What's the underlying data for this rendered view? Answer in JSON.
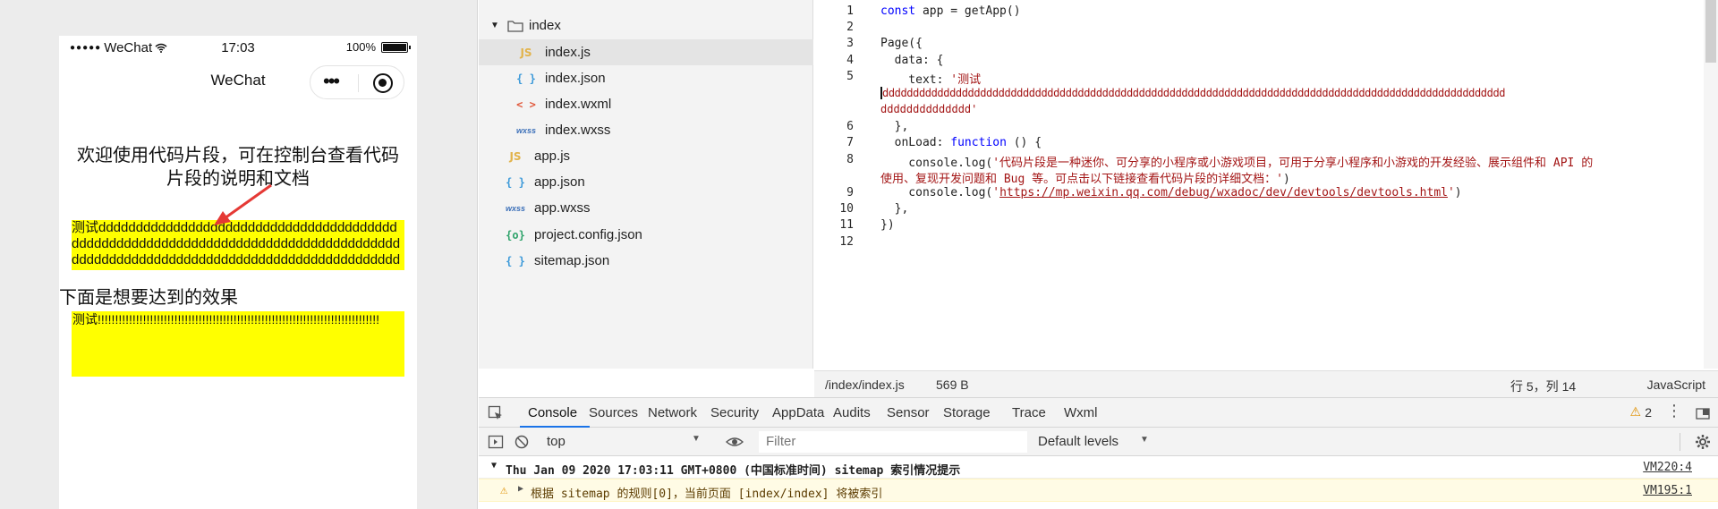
{
  "simulator": {
    "status": {
      "carrier": "WeChat",
      "time": "17:03",
      "battery": "100%"
    },
    "nav_title": "WeChat",
    "intro": "欢迎使用代码片段，可在控制台查看代码片段的说明和文档",
    "text1": "测试dddddddddddddddddddddddddddddddddddddddddddddddddddddddddddddddddddddddddddddddddddddddddddddddddddddddddddddddddddddddddddddddddddddddddddd",
    "below_label": "下面是想要达到的效果",
    "text2": "测试!!!!!!!!!!!!!!!!!!!!!!!!!!!!!!!!!!!!!!!!!!!!!!!!!!!!!!!!!!!!!!!!!!!!!!!!!!!!!!!!!"
  },
  "file_tree": {
    "folder": "index",
    "items": [
      {
        "icon": "JS",
        "kind": "js",
        "label": "index.js",
        "selected": true
      },
      {
        "icon": "{ }",
        "kind": "json",
        "label": "index.json"
      },
      {
        "icon": "< >",
        "kind": "wxml",
        "label": "index.wxml"
      },
      {
        "icon": "wxss",
        "kind": "wxss",
        "label": "index.wxss"
      },
      {
        "icon": "JS",
        "kind": "js",
        "label": "app.js"
      },
      {
        "icon": "{ }",
        "kind": "json",
        "label": "app.json"
      },
      {
        "icon": "wxss",
        "kind": "wxss",
        "label": "app.wxss"
      },
      {
        "icon": "{o}",
        "kind": "cfg",
        "label": "project.config.json"
      },
      {
        "icon": "{ }",
        "kind": "json",
        "label": "sitemap.json"
      }
    ]
  },
  "editor": {
    "line_numbers": [
      "1",
      "2",
      "3",
      "4",
      "5",
      "6",
      "7",
      "8",
      "9",
      "10",
      "11",
      "12"
    ],
    "code": {
      "l1_kw": "const",
      "l1_rest": " app = getApp()",
      "l3": "Page({",
      "l4": "  data: {",
      "l5_key": "    text: ",
      "l5_str": "'测试",
      "l5_wrap1": "dddddddddddddddddddddddddddddddddddddddddddddddddddddddddddddddddddddddddddddddddddddddddddddddddddddd",
      "l5_wrap2": "dddddddddddddd'",
      "l6": "  },",
      "l7_a": "  onLoad: ",
      "l7_kw": "function",
      "l7_b": " () {",
      "l8_a": "    console.log(",
      "l8_str1": "'代码片段是一种迷你、可分享的小程序或小游戏项目，可用于分享小程序和小游戏的开发经验、展示组件和 API 的",
      "l8_str2": "使用、复现开发问题和 Bug 等。可点击以下链接查看代码片段的详细文档：'",
      "l8_b": ")",
      "l9_a": "    console.log(",
      "l9_q1": "'",
      "l9_link": "https://mp.weixin.qq.com/debug/wxadoc/dev/devtools/devtools.html",
      "l9_q2": "'",
      "l9_b": ")",
      "l10": "  },",
      "l11": "})"
    },
    "status": {
      "path": "/index/index.js",
      "size": "569 B",
      "position": "行 5，列 14",
      "language": "JavaScript"
    }
  },
  "devtools": {
    "tabs": [
      "Console",
      "Sources",
      "Network",
      "Security",
      "AppData",
      "Audits",
      "Sensor",
      "Storage",
      "Trace",
      "Wxml"
    ],
    "active_tab": "Console",
    "warning_count": "2",
    "context": "top",
    "filter_placeholder": "Filter",
    "levels": "Default levels",
    "messages": [
      {
        "text": "Thu Jan 09 2020 17:03:11 GMT+0800 (中国标准时间) sitemap 索引情况提示",
        "source": "VM220:4"
      },
      {
        "text": "根据 sitemap 的规则[0]，当前页面 [index/index] 将被索引",
        "source": "VM195:1"
      }
    ]
  },
  "colors": {
    "highlight": "#ffff00",
    "arrow": "#e53935",
    "accent": "#1a73e8",
    "warning": "#f0a000"
  }
}
